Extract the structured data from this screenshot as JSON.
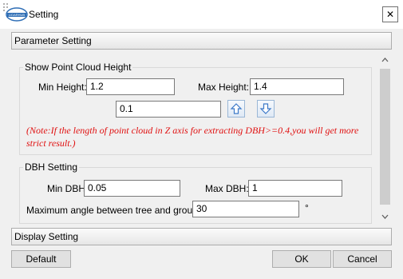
{
  "window": {
    "title": "Setting",
    "close_label": "✕",
    "logo_text": "LIDARHUB"
  },
  "sections": {
    "parameter": "Parameter Setting",
    "display": "Display Setting"
  },
  "point_cloud": {
    "group_title": "Show Point Cloud Height",
    "min_height_label": "Min Height:",
    "min_height_value": "1.2",
    "max_height_label": "Max Height:",
    "max_height_value": "1.4",
    "step_value": "0.1",
    "note": "(Note:If the length of point cloud in Z axis for extracting DBH>=0.4,you will get more strict result.)"
  },
  "dbh": {
    "group_title": "DBH Setting",
    "min_dbh_label": "Min DBH:",
    "min_dbh_value": "0.05",
    "max_dbh_label": "Max DBH:",
    "max_dbh_value": "1",
    "angle_label": "Maximum angle between tree and ground:",
    "angle_value": "30",
    "angle_unit": "°"
  },
  "buttons": {
    "default": "Default",
    "ok": "OK",
    "cancel": "Cancel"
  },
  "colors": {
    "note_red": "#e01010",
    "arrow_blue": "#3b78c8"
  }
}
